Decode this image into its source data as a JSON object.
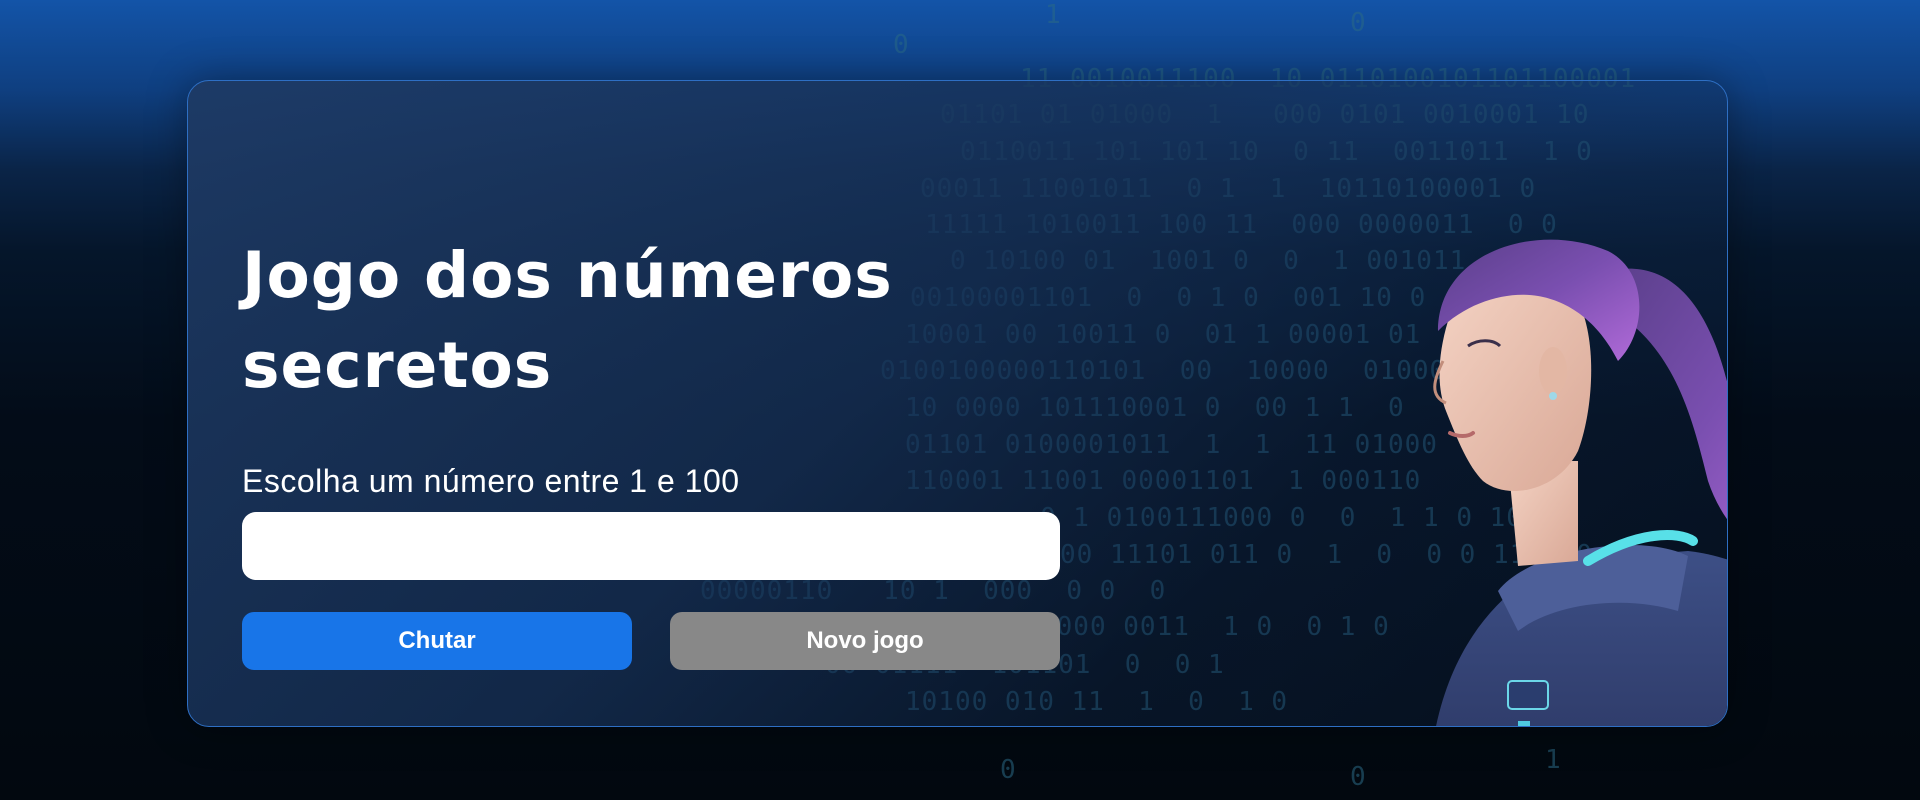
{
  "game": {
    "title": "Jogo dos números secretos",
    "prompt": "Escolha um número entre 1 e 100",
    "input_value": "",
    "guess_button": "Chutar",
    "new_game_button": "Novo jogo"
  },
  "background": {
    "code_lines": [
      "1",
      "0",
      "0",
      "11 0010011100  10 0110100101101100001",
      "01101 01 01000  1   000 0101 0010001 10",
      "0110011 101 101 10  0 11  0011011  1 0",
      "00011 11001011  0 1  1  10110100001 0",
      "11111 1010011 100 11  000 0000011  0 0",
      "0 10100 01  1001 0  0  1 001011",
      "00100001101  0  0 1 0  001 10 0",
      "10001 00 10011 0  01 1 00001 01",
      "0100100000110101  00  10000  0100011 00",
      "10 0000 101110001 0  00 1 1  0",
      "01101 0100001011  1  1  11 01000",
      "110001 11001 00001101  1 000110",
      "0 1 0100111000 0  0  1 1 0 1030",
      "00 11101 011 0  1  0  0 0 11 100",
      "00000110   10 1  000  0 0  0",
      "0000 0011  1 0  0 1 0",
      "00 01111  101101  0  0 1",
      "10100 010 11  1  0  1 0",
      "0",
      "0",
      "1"
    ],
    "accent_color": "#1875e8",
    "secondary_color": "#888888"
  }
}
